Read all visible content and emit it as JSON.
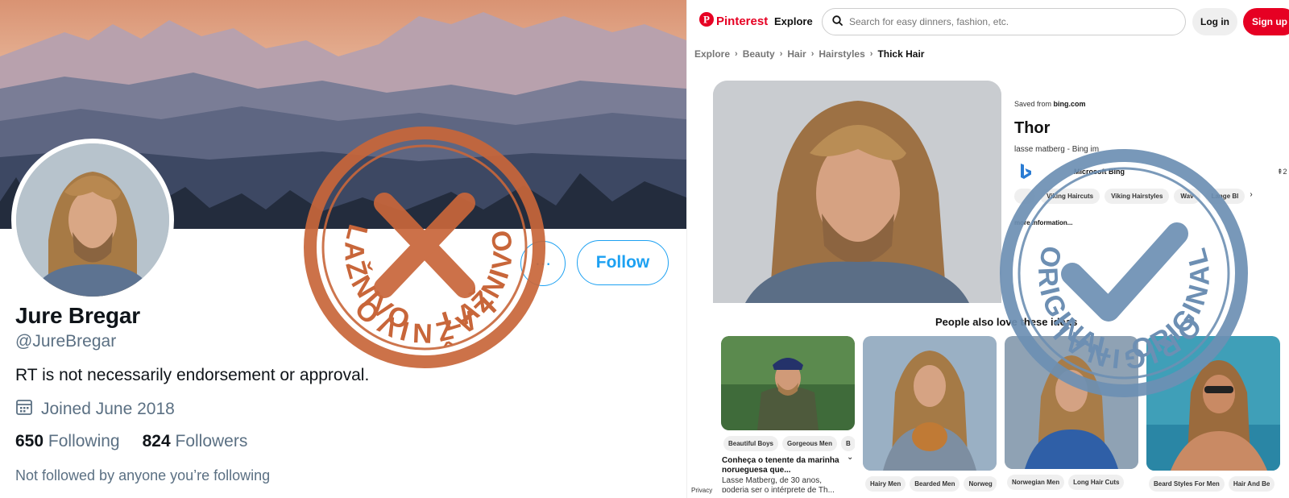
{
  "twitter": {
    "name": "Jure Bregar",
    "handle": "@JureBregar",
    "bio": "RT is not necessarily endorsement or approval.",
    "joined": "Joined June 2018",
    "following_count": "650",
    "following_label": "Following",
    "followers_count": "824",
    "followers_label": "Followers",
    "not_followed": "Not followed by anyone you’re following",
    "follow_label": "Follow",
    "more_icon": "ellipsis-icon"
  },
  "pinterest": {
    "brand": "Pinterest",
    "explore": "Explore",
    "search_placeholder": "Search for easy dinners, fashion, etc.",
    "login": "Log in",
    "signup": "Sign up",
    "breadcrumb": [
      "Explore",
      "Beauty",
      "Hair",
      "Hairstyles",
      "Thick Hair"
    ],
    "saved_from_prefix": "Saved from ",
    "saved_from_domain": "bing.com",
    "pin_title": "Thor",
    "pin_desc": "lasse matberg - Bing im",
    "bing_name": "Microsoft Bing",
    "bing_count": "2",
    "pin_tags": [
      "",
      "Viking Haircuts",
      "Viking Hairstyles",
      "Wav",
      "Lange Bl"
    ],
    "more_info": "more information...",
    "people_also": "People also love these ideas",
    "cards": [
      {
        "tags": [
          "Beautiful Boys",
          "Gorgeous Men",
          "B"
        ],
        "title": "Conheça o tenente da marinha norueguesa que...",
        "desc": "Lasse Matberg, de 30 anos, poderia ser o intérprete de Th..."
      },
      {
        "tags": [
          "Hairy Men",
          "Bearded Men",
          "Norweg"
        ]
      },
      {
        "tags": [
          "Norwegian Men",
          "Long Hair Cuts"
        ]
      },
      {
        "tags": [
          "Beard Styles For Men",
          "Hair And Be"
        ]
      }
    ],
    "privacy": "Privacy"
  },
  "stamps": {
    "fake_text": "LAŽNIVO",
    "original_text": "ORIGINAL",
    "fake_color": "#c8663a",
    "original_color": "#6d8fb3"
  },
  "colors": {
    "twitter_blue": "#1da1f2",
    "pinterest_red": "#e60023"
  }
}
